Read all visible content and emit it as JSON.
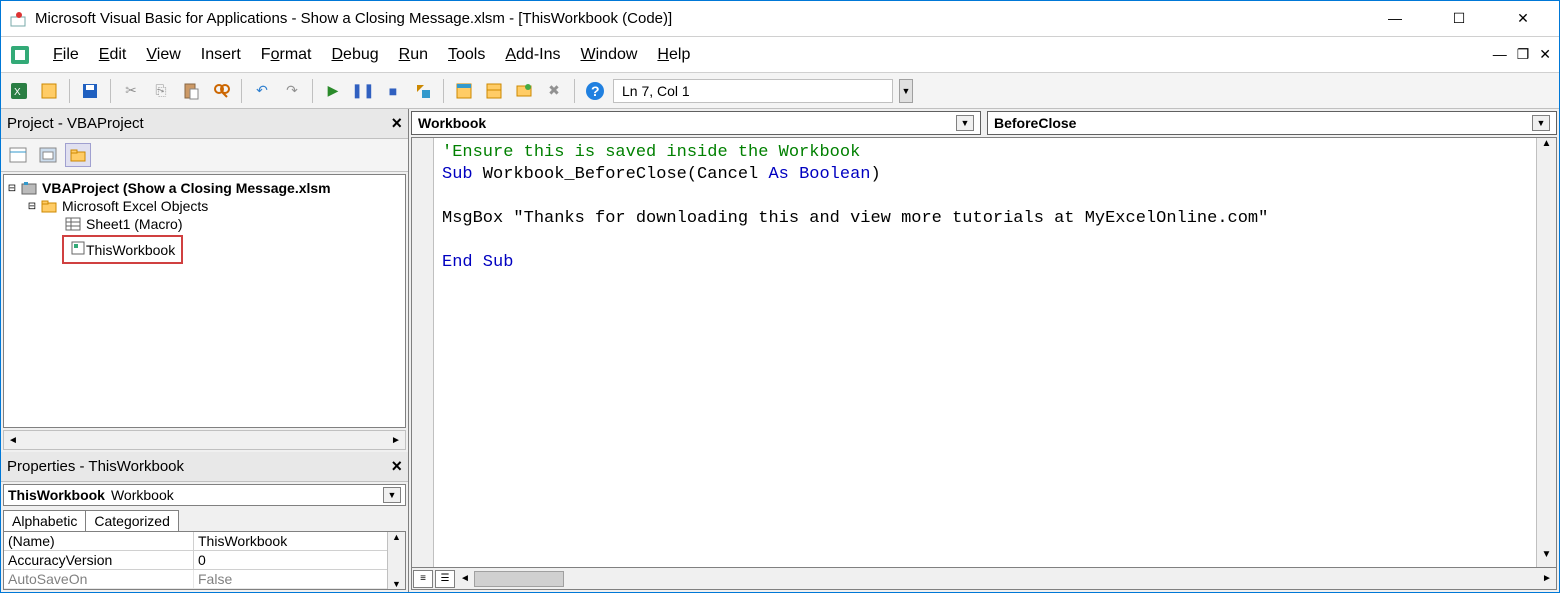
{
  "titlebar": {
    "title": "Microsoft Visual Basic for Applications - Show a Closing Message.xlsm - [ThisWorkbook (Code)]"
  },
  "menus": {
    "file": "File",
    "edit": "Edit",
    "view": "View",
    "insert": "Insert",
    "format": "Format",
    "debug": "Debug",
    "run": "Run",
    "tools": "Tools",
    "addins": "Add-Ins",
    "window": "Window",
    "help": "Help"
  },
  "toolbar": {
    "cursor_pos": "Ln 7, Col 1"
  },
  "project_panel": {
    "title": "Project - VBAProject",
    "root": "VBAProject (Show a Closing Message.xlsm",
    "folder": "Microsoft Excel Objects",
    "sheet1": "Sheet1 (Macro)",
    "thiswb": "ThisWorkbook"
  },
  "properties_panel": {
    "title": "Properties - ThisWorkbook",
    "combo_bold": "ThisWorkbook",
    "combo_rest": "Workbook",
    "tab_alpha": "Alphabetic",
    "tab_cat": "Categorized",
    "rows": {
      "name_k": "(Name)",
      "name_v": "ThisWorkbook",
      "acc_k": "AccuracyVersion",
      "acc_v": "0",
      "auto_k": "AutoSaveOn",
      "auto_v": "False"
    }
  },
  "code_panel": {
    "object_combo": "Workbook",
    "proc_combo": "BeforeClose",
    "comment": "'Ensure this is saved inside the Workbook",
    "sub_kw": "Sub",
    "sub_name": " Workbook_BeforeClose(Cancel ",
    "as_kw": "As",
    "bool_kw": " Boolean",
    "paren": ")",
    "msg_line": "MsgBox \"Thanks for downloading this and view more tutorials at MyExcelOnline.com\"",
    "end_sub": "End Sub"
  }
}
